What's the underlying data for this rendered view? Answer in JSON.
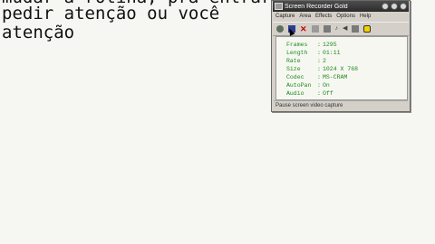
{
  "document": {
    "lines": [
      "mudar a rotina, pra entrar ou",
      "pedir atenção ou você",
      "atenção"
    ]
  },
  "recorder": {
    "title": "Screen Recorder Gold",
    "menu": [
      "Capture",
      "Area",
      "Effects",
      "Options",
      "Help"
    ],
    "toolbar_icons": [
      "record-icon",
      "movie-icon",
      "stop-icon",
      "square-icon",
      "square-icon",
      "sound-icon",
      "speaker-icon",
      "square-icon",
      "smiley-icon"
    ],
    "info": [
      {
        "label": "Frames",
        "value": "1295"
      },
      {
        "label": "Length",
        "value": "01:11"
      },
      {
        "label": "Rate",
        "value": "2"
      },
      {
        "label": "Size",
        "value": "1024 X 768"
      },
      {
        "label": "Codec",
        "value": "MS-CRAM"
      },
      {
        "label": "AutoPan",
        "value": "On"
      },
      {
        "label": "Audio",
        "value": "Off"
      }
    ],
    "status": "Pause screen video capture",
    "accent_color": "#1b8a1b"
  }
}
